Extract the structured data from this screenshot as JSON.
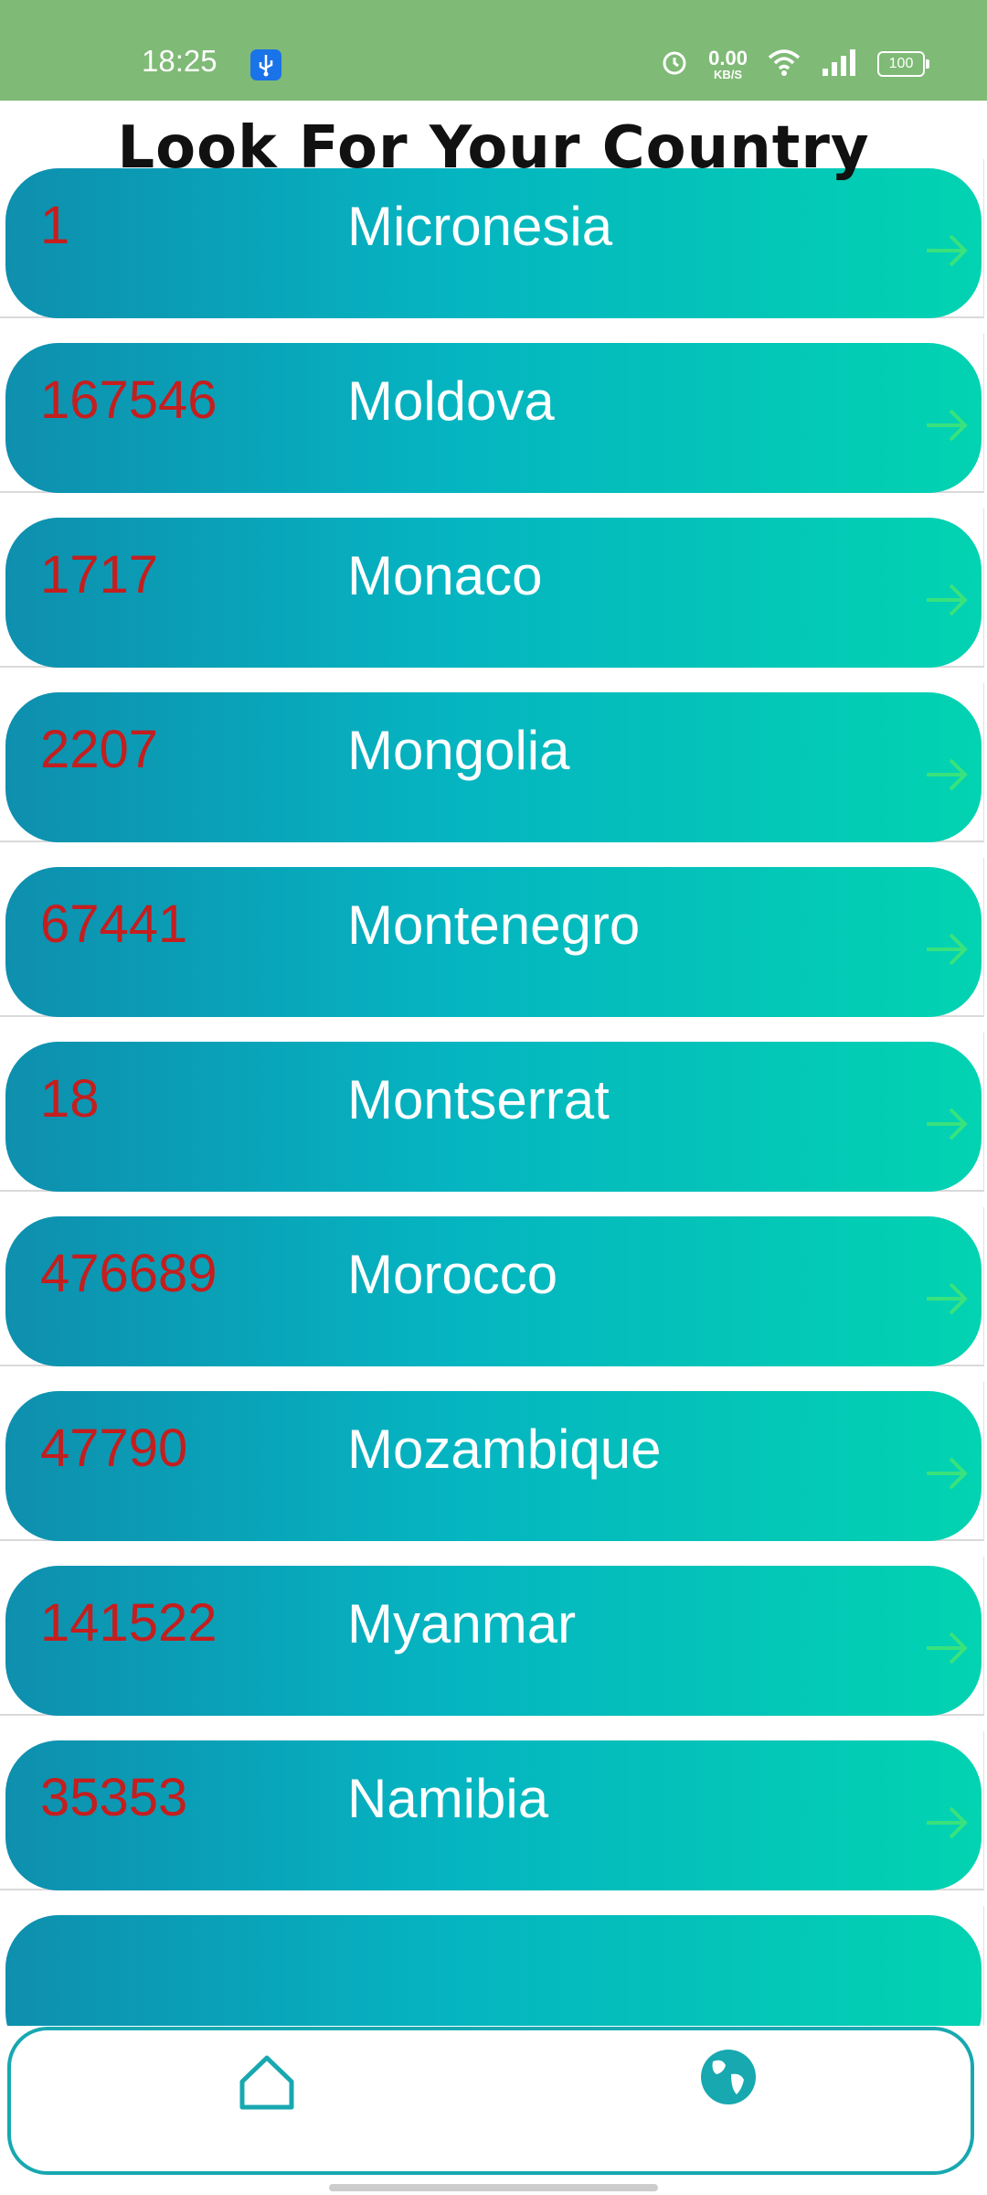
{
  "status_bar": {
    "time": "18:25",
    "net_speed_value": "0.00",
    "net_speed_unit": "KB/S",
    "battery": "100",
    "icons": [
      "usb-icon",
      "alarm-icon",
      "wifi-icon",
      "signal-icon",
      "battery-icon"
    ]
  },
  "header": {
    "title": "Look For Your Country"
  },
  "countries": [
    {
      "count": "1",
      "name": "Micronesia"
    },
    {
      "count": "167546",
      "name": "Moldova"
    },
    {
      "count": "1717",
      "name": "Monaco"
    },
    {
      "count": "2207",
      "name": "Mongolia"
    },
    {
      "count": "67441",
      "name": "Montenegro"
    },
    {
      "count": "18",
      "name": "Montserrat"
    },
    {
      "count": "476689",
      "name": "Morocco"
    },
    {
      "count": "47790",
      "name": "Mozambique"
    },
    {
      "count": "141522",
      "name": "Myanmar"
    },
    {
      "count": "35353",
      "name": "Namibia"
    }
  ],
  "bottom_nav": {
    "items": [
      {
        "icon": "home-icon"
      },
      {
        "icon": "globe-icon"
      }
    ]
  },
  "colors": {
    "status_bar": "#7fba76",
    "gradient_start": "#0e8fae",
    "gradient_end": "#02d3b1",
    "count_text": "#c41e1e",
    "arrow": "#39e27c",
    "nav_accent": "#17a8b0"
  }
}
